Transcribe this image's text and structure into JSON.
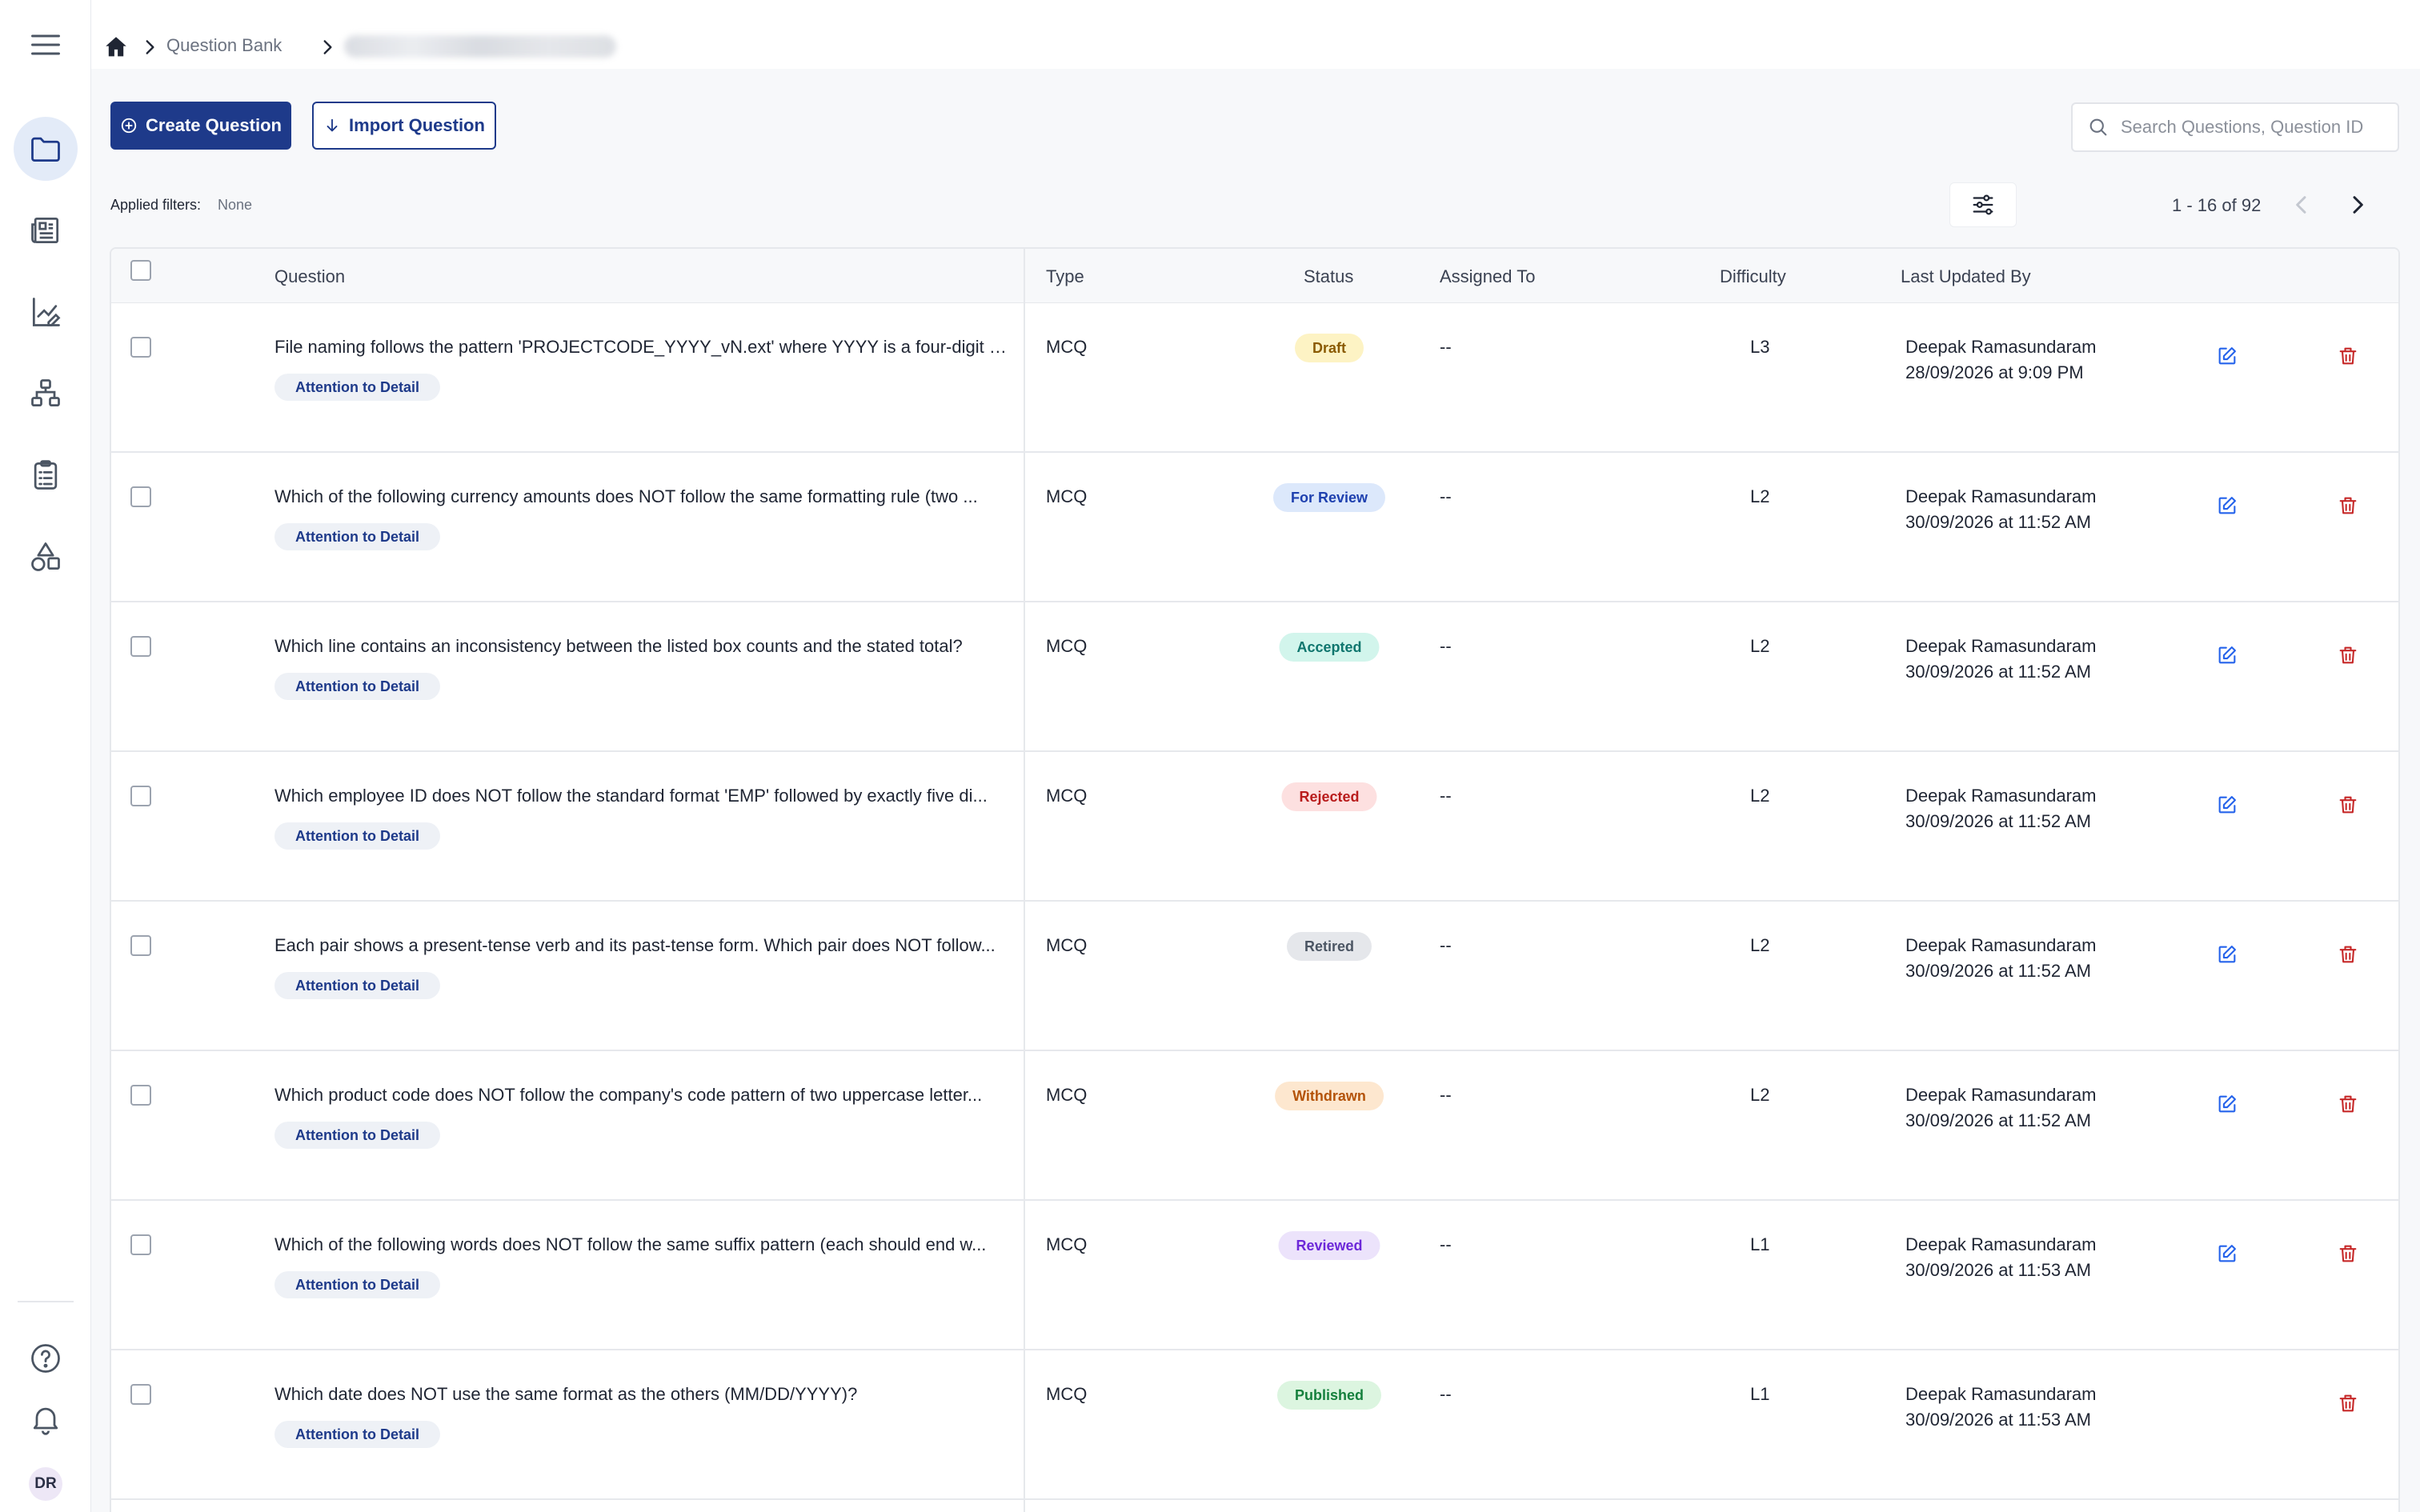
{
  "breadcrumb": {
    "section": "Question Bank"
  },
  "actions": {
    "create_label": "Create Question",
    "import_label": "Import Question"
  },
  "search": {
    "placeholder": "Search Questions, Question ID"
  },
  "filters": {
    "label": "Applied filters:",
    "value": "None"
  },
  "pagination": {
    "text": "1 - 16 of 92"
  },
  "table": {
    "headers": {
      "question": "Question",
      "type": "Type",
      "status": "Status",
      "assigned": "Assigned To",
      "difficulty": "Difficulty",
      "updated": "Last Updated By"
    },
    "rows": [
      {
        "question": "File naming follows the pattern 'PROJECTCODE_YYYY_vN.ext' where YYYY is a four-digit y...",
        "tag": "Attention to Detail",
        "type": "MCQ",
        "status": "Draft",
        "status_bg": "#fdf3c4",
        "status_fg": "#8a5a00",
        "assigned": "--",
        "difficulty": "L3",
        "updated_by": "Deepak Ramasundaram",
        "updated_at": "28/09/2026 at 9:09 PM",
        "editable": true
      },
      {
        "question": "Which of the following currency amounts does NOT follow the same formatting rule (two ...",
        "tag": "Attention to Detail",
        "type": "MCQ",
        "status": "For Review",
        "status_bg": "#dce8fb",
        "status_fg": "#1e40af",
        "assigned": "--",
        "difficulty": "L2",
        "updated_by": "Deepak Ramasundaram",
        "updated_at": "30/09/2026 at 11:52 AM",
        "editable": true
      },
      {
        "question": "Which line contains an inconsistency between the listed box counts and the stated total?",
        "tag": "Attention to Detail",
        "type": "MCQ",
        "status": "Accepted",
        "status_bg": "#d2f5ec",
        "status_fg": "#0f766e",
        "assigned": "--",
        "difficulty": "L2",
        "updated_by": "Deepak Ramasundaram",
        "updated_at": "30/09/2026 at 11:52 AM",
        "editable": true
      },
      {
        "question": "Which employee ID does NOT follow the standard format 'EMP' followed by exactly five di...",
        "tag": "Attention to Detail",
        "type": "MCQ",
        "status": "Rejected",
        "status_bg": "#fde0e0",
        "status_fg": "#b91c1c",
        "assigned": "--",
        "difficulty": "L2",
        "updated_by": "Deepak Ramasundaram",
        "updated_at": "30/09/2026 at 11:52 AM",
        "editable": true
      },
      {
        "question": "Each pair shows a present-tense verb and its past-tense form. Which pair does NOT follow...",
        "tag": "Attention to Detail",
        "type": "MCQ",
        "status": "Retired",
        "status_bg": "#e5e7eb",
        "status_fg": "#4b5563",
        "assigned": "--",
        "difficulty": "L2",
        "updated_by": "Deepak Ramasundaram",
        "updated_at": "30/09/2026 at 11:52 AM",
        "editable": true
      },
      {
        "question": "Which product code does NOT follow the company's code pattern of two uppercase letter...",
        "tag": "Attention to Detail",
        "type": "MCQ",
        "status": "Withdrawn",
        "status_bg": "#fde7cf",
        "status_fg": "#b45309",
        "assigned": "--",
        "difficulty": "L2",
        "updated_by": "Deepak Ramasundaram",
        "updated_at": "30/09/2026 at 11:52 AM",
        "editable": true
      },
      {
        "question": "Which of the following words does NOT follow the same suffix pattern (each should end w...",
        "tag": "Attention to Detail",
        "type": "MCQ",
        "status": "Reviewed",
        "status_bg": "#ece3fb",
        "status_fg": "#6d28d9",
        "assigned": "--",
        "difficulty": "L1",
        "updated_by": "Deepak Ramasundaram",
        "updated_at": "30/09/2026 at 11:53 AM",
        "editable": true
      },
      {
        "question": "Which date does NOT use the same format as the others (MM/DD/YYYY)?",
        "tag": "Attention to Detail",
        "type": "MCQ",
        "status": "Published",
        "status_bg": "#dcf5e0",
        "status_fg": "#15803d",
        "assigned": "--",
        "difficulty": "L1",
        "updated_by": "Deepak Ramasundaram",
        "updated_at": "30/09/2026 at 11:53 AM",
        "editable": false
      }
    ]
  },
  "user": {
    "initials": "DR"
  },
  "icons": {
    "sidebar": [
      "menu-icon",
      "folder-icon",
      "newspaper-icon",
      "chart-edit-icon",
      "hierarchy-icon",
      "clipboard-list-icon",
      "shapes-icon",
      "help-icon",
      "bell-icon"
    ],
    "row": [
      "edit-icon",
      "delete-icon"
    ]
  },
  "colors": {
    "primary": "#1e3a8a",
    "delete": "#c62828",
    "edit": "#2563eb"
  }
}
